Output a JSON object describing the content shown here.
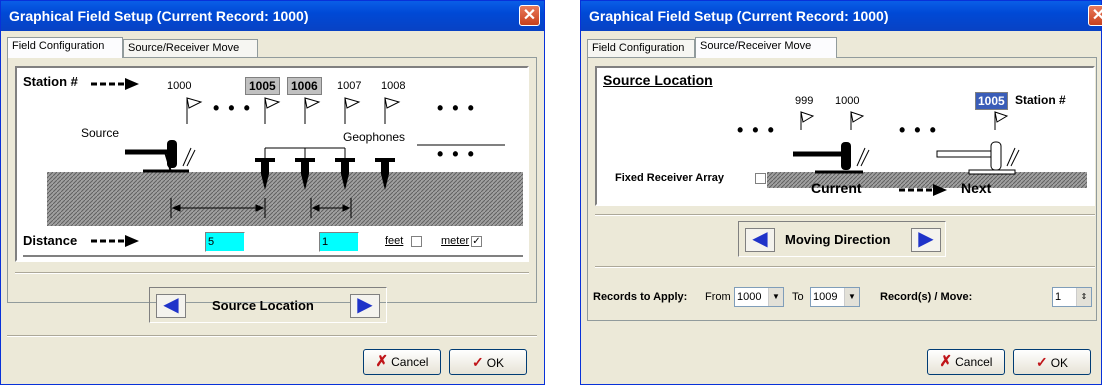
{
  "dialog1": {
    "title": "Graphical Field Setup (Current Record: 1000)",
    "close_glyph": "✕",
    "tabs": [
      "Field Configuration",
      "Source/Receiver Move"
    ],
    "station_label": "Station #",
    "stations": [
      "1000",
      "1005",
      "1006",
      "1007",
      "1008"
    ],
    "source_label": "Source",
    "geophones_label": "Geophones",
    "dots": "• • •",
    "distance_label": "Distance",
    "distance_value_1": "5",
    "distance_value_2": "1",
    "feet_label": "feet",
    "meter_label": "meter",
    "feet_checked": false,
    "meter_checked": true,
    "nav_label": "Source Location",
    "cancel_label": "Cancel",
    "ok_label": "OK"
  },
  "dialog2": {
    "title": "Graphical Field Setup (Current Record: 1000)",
    "close_glyph": "✕",
    "tabs": [
      "Field Configuration",
      "Source/Receiver Move"
    ],
    "heading": "Source Location",
    "stations": [
      "999",
      "1000",
      "1005"
    ],
    "station_suffix": "Station #",
    "dots": "• • •",
    "fixed_receiver_label": "Fixed Receiver Array",
    "current_label": "Current",
    "next_label": "Next",
    "nav_label": "Moving Direction",
    "records_label": "Records to Apply:",
    "from_label": "From",
    "from_value": "1000",
    "to_label": "To",
    "to_value": "1009",
    "per_move_label": "Record(s) / Move:",
    "per_move_value": "1",
    "cancel_label": "Cancel",
    "ok_label": "OK"
  },
  "colors": {
    "titlebar": "#0a5ee7",
    "cyan": "#00ffff",
    "arrow_blue": "#1f33c9",
    "arrow_red": "#d01010"
  }
}
